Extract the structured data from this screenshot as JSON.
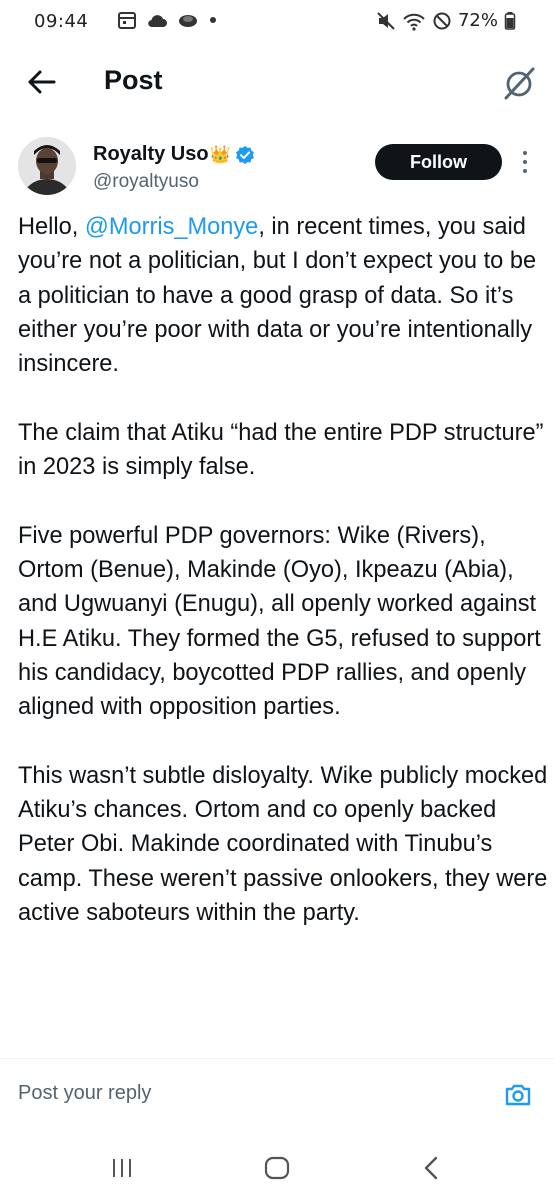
{
  "status_bar": {
    "time": "09:44",
    "battery_percent": "72%",
    "left_icons": [
      "calendar-icon",
      "cloud-icon",
      "weather-icon",
      "dot-icon"
    ],
    "right_icons": [
      "mute-icon",
      "wifi-icon",
      "no-disturb-icon",
      "battery-icon"
    ]
  },
  "header": {
    "title": "Post"
  },
  "author": {
    "name": "Royalty Uso",
    "emoji": "👑",
    "handle": "@royaltyuso",
    "verified": true,
    "follow_label": "Follow"
  },
  "tweet": {
    "p1_prefix": "Hello, ",
    "p1_mention": "@Morris_Monye",
    "p1_rest": ", in recent times, you said you’re not a politician, but I don’t expect you to be a politician to have a good grasp of data. So it’s either you’re poor with data or you’re intentionally insincere.",
    "p2": "The claim that Atiku “had the entire PDP structure” in 2023 is simply false.",
    "p3": "Five powerful PDP governors: Wike (Rivers), Ortom (Benue), Makinde (Oyo), Ikpeazu (Abia), and Ugwuanyi (Enugu), all openly worked against H.E Atiku. They formed the G5, refused to support his candidacy, boycotted PDP rallies, and openly aligned with opposition parties.",
    "p4": "This wasn’t subtle disloyalty. Wike publicly mocked Atiku’s chances. Ortom and co openly backed Peter Obi. Makinde coordinated with Tinubu’s camp. These weren’t passive onlookers, they were active saboteurs within the party."
  },
  "reply": {
    "placeholder": "Post your reply"
  },
  "colors": {
    "accent": "#1d9bf0",
    "text": "#0f1419",
    "muted": "#536471"
  }
}
